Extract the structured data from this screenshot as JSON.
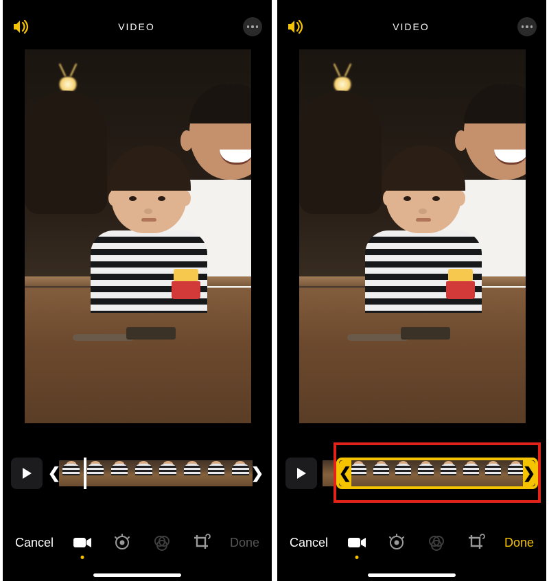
{
  "accent": "#f5c300",
  "screens": [
    {
      "id": "left",
      "title": "VIDEO",
      "timeline_selected": false,
      "cancel_label": "Cancel",
      "done_label": "Done",
      "done_state": "dim"
    },
    {
      "id": "right",
      "title": "VIDEO",
      "timeline_selected": true,
      "cancel_label": "Cancel",
      "done_label": "Done",
      "done_state": "accent"
    }
  ],
  "handles": {
    "left": "❮",
    "right": "❯"
  },
  "tools": [
    {
      "name": "video",
      "active": true,
      "dim": false
    },
    {
      "name": "adjust",
      "active": false,
      "dim": false
    },
    {
      "name": "filters",
      "active": false,
      "dim": true
    },
    {
      "name": "crop",
      "active": false,
      "dim": false
    }
  ]
}
